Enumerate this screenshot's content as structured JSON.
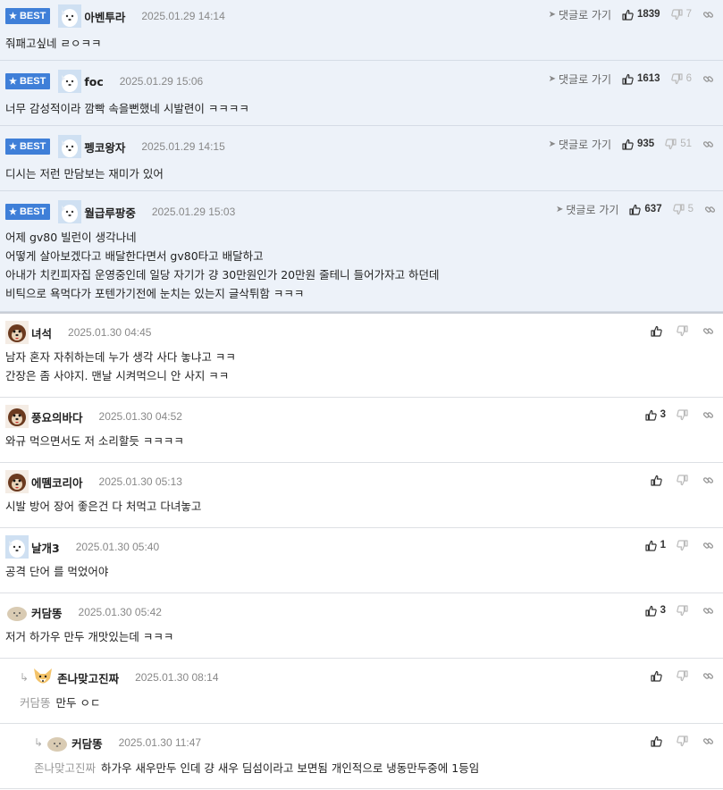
{
  "ui": {
    "best_label": "BEST",
    "goto_label": "댓글로 가기"
  },
  "best": [
    {
      "nick": "아벤투라",
      "date": "2025.01.29 14:14",
      "up": "1839",
      "down": "7",
      "lines": [
        "줘패고싶네 ㄹㅇㅋㅋ"
      ]
    },
    {
      "nick": "foc",
      "date": "2025.01.29 15:06",
      "up": "1613",
      "down": "6",
      "lines": [
        "너무 감성적이라 깜빡 속을뻔했네 시발련이 ㅋㅋㅋㅋ"
      ]
    },
    {
      "nick": "펭코왕자",
      "date": "2025.01.29 14:15",
      "up": "935",
      "down": "51",
      "lines": [
        "디시는 저런 만담보는 재미가 있어"
      ]
    },
    {
      "nick": "월급루팡중",
      "date": "2025.01.29 15:03",
      "up": "637",
      "down": "5",
      "lines": [
        "어제 gv80 빌런이 생각나네",
        "어떻게 살아보겠다고 배달한다면서 gv80타고 배달하고",
        "아내가 치킨피자집 운영중인데 일당 자기가 걍 30만원인가 20만원 줄테니 들어가자고 하던데",
        "비틱으로 욕먹다가 포텐가기전에 눈치는 있는지 글삭튀함 ㅋㅋㅋ"
      ]
    }
  ],
  "comments": [
    {
      "nick": "녀석",
      "date": "2025.01.30 04:45",
      "up": "",
      "lines": [
        "남자 혼자 자취하는데 누가 생각 사다 놓냐고 ㅋㅋ",
        "간장은 좀 사야지. 맨날 시켜먹으니 안 사지 ㅋㅋ"
      ]
    },
    {
      "nick": "풍요의바다",
      "date": "2025.01.30 04:52",
      "up": "3",
      "lines": [
        "와규 먹으면서도 저 소리할듯 ㅋㅋㅋㅋ"
      ]
    },
    {
      "nick": "에뗌코리아",
      "date": "2025.01.30 05:13",
      "up": "",
      "lines": [
        "시발 방어 장어 좋은건 다 처먹고 다녀놓고"
      ]
    },
    {
      "nick": "날개3",
      "date": "2025.01.30 05:40",
      "up": "1",
      "lines": [
        "공격 단어 를 먹었어야"
      ]
    },
    {
      "nick": "커담똥",
      "date": "2025.01.30 05:42",
      "up": "3",
      "lines": [
        "저거 하가우 만두 개맛있는데 ㅋㅋㅋ"
      ]
    }
  ],
  "replies": [
    {
      "nick": "존나맞고진짜",
      "date": "2025.01.30 08:14",
      "mention": "커담똥",
      "text": "만두 ㅇㄷ"
    },
    {
      "nick": "커담똥",
      "date": "2025.01.30 11:47",
      "mention": "존나맞고진짜",
      "text": "하가우 새우만두 인데 걍 새우 딤섬이라고 보면됨 개인적으로 냉동만두중에 1등임"
    }
  ],
  "colors": {
    "best_badge": "#3f7fd8",
    "best_bg": "#edf2f9"
  }
}
